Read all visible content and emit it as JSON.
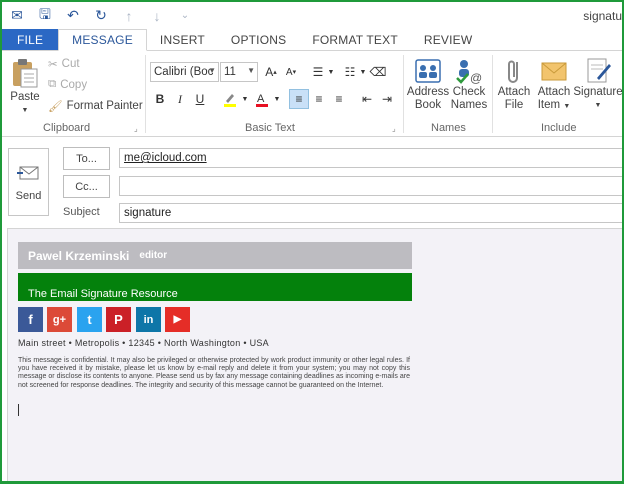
{
  "window": {
    "title": "signatu"
  },
  "qat": {
    "items": [
      {
        "name": "mail-icon",
        "glyph": "✉"
      },
      {
        "name": "save-icon",
        "glyph": "🖫"
      },
      {
        "name": "undo-icon",
        "glyph": "↶"
      },
      {
        "name": "redo-icon",
        "glyph": "↻"
      },
      {
        "name": "up-arrow-icon",
        "glyph": "↑"
      },
      {
        "name": "down-arrow-icon",
        "glyph": "↓"
      },
      {
        "name": "customize-icon",
        "glyph": "⌄"
      }
    ]
  },
  "tabs": [
    "FILE",
    "MESSAGE",
    "INSERT",
    "OPTIONS",
    "FORMAT TEXT",
    "REVIEW"
  ],
  "ribbon": {
    "clipboard": {
      "label": "Clipboard",
      "paste": "Paste",
      "cut": "Cut",
      "copy": "Copy",
      "format_painter": "Format Painter"
    },
    "basic_text": {
      "label": "Basic Text",
      "font": "Calibri (Boc",
      "size": "11",
      "bold": "B",
      "italic": "I",
      "underline": "U"
    },
    "names": {
      "label": "Names",
      "address_book": [
        "Address",
        "Book"
      ],
      "check_names": [
        "Check",
        "Names"
      ]
    },
    "include": {
      "label": "Include",
      "attach_file": [
        "Attach",
        "File"
      ],
      "attach_item": [
        "Attach",
        "Item"
      ],
      "signature": "Signature"
    }
  },
  "compose": {
    "send": "Send",
    "to_button": "To...",
    "cc_button": "Cc...",
    "subject_label": "Subject",
    "to_value": "me@icloud.com",
    "cc_value": "",
    "subject_value": "signature"
  },
  "signature": {
    "name": "Pawel Krzeminski",
    "role": "editor",
    "org": "The Email Signature Resource",
    "address": "Main street • Metropolis • 12345 • North Washington • USA",
    "disclaimer": "This message is confidential. It may also be privileged or otherwise protected by work product immunity or other legal rules. If you have received it by mistake, please let us know by e-mail reply and delete it from your system; you may not copy this message or disclose its contents to anyone. Please send us by fax any message containing deadlines as incoming e-mails are not screened for response deadlines. The integrity and security of this message cannot be guaranteed on the Internet.",
    "social": [
      {
        "name": "facebook-icon",
        "glyph": "f",
        "color": "#3b5998"
      },
      {
        "name": "google-plus-icon",
        "glyph": "g+",
        "color": "#dc4a38"
      },
      {
        "name": "twitter-icon",
        "glyph": "t",
        "color": "#2aa3ef"
      },
      {
        "name": "pinterest-icon",
        "glyph": "P",
        "color": "#cb2027"
      },
      {
        "name": "linkedin-icon",
        "glyph": "in",
        "color": "#0e76a8"
      },
      {
        "name": "youtube-icon",
        "glyph": "▶",
        "color": "#e52d27"
      }
    ]
  },
  "colors": {
    "accent": "#2b579a",
    "file_tab": "#2b68c4",
    "frame": "#1f9a3a",
    "sig_green": "#04810c",
    "sig_grey": "#bdbcc1"
  }
}
